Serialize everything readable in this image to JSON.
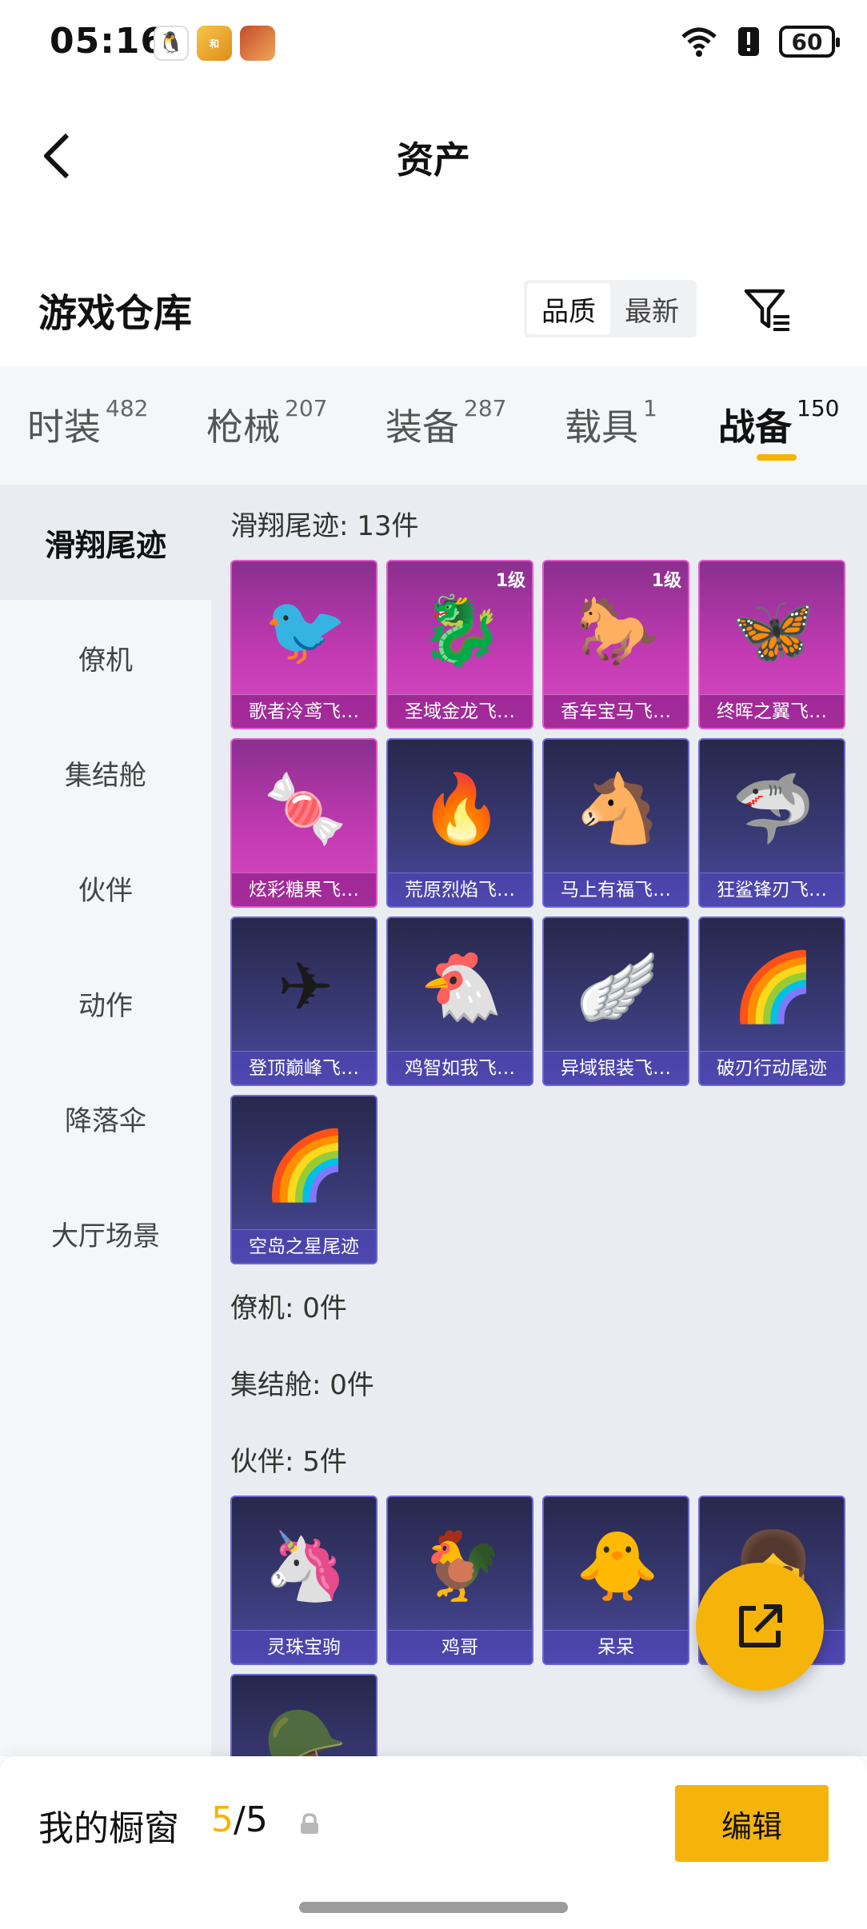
{
  "status_bar": {
    "time": "05:16",
    "battery": "60"
  },
  "nav": {
    "title": "资产"
  },
  "warehouse": {
    "title": "游戏仓库",
    "sort_options": [
      "品质",
      "最新"
    ],
    "active_sort": "品质"
  },
  "categories": [
    {
      "label": "时装",
      "count": "482"
    },
    {
      "label": "枪械",
      "count": "207"
    },
    {
      "label": "装备",
      "count": "287"
    },
    {
      "label": "载具",
      "count": "1"
    },
    {
      "label": "战备",
      "count": "150"
    }
  ],
  "active_category": "战备",
  "sidebar": {
    "items": [
      "滑翔尾迹",
      "僚机",
      "集结舱",
      "伙伴",
      "动作",
      "降落伞",
      "大厅场景"
    ],
    "active": "滑翔尾迹"
  },
  "sections": {
    "glide": {
      "title": "滑翔尾迹: 13件",
      "items": [
        {
          "label": "歌者泠鸢飞…",
          "level": "",
          "icon": "red-bird",
          "glyph": "🐦"
        },
        {
          "label": "圣域金龙飞…",
          "level": "1级",
          "icon": "golden-dragon",
          "glyph": "🐉"
        },
        {
          "label": "香车宝马飞…",
          "level": "1级",
          "icon": "carriage",
          "glyph": "🐎"
        },
        {
          "label": "终晖之翼飞…",
          "level": "",
          "icon": "wings",
          "glyph": "🦋"
        },
        {
          "label": "炫彩糖果飞…",
          "level": "",
          "icon": "candy",
          "glyph": "🍬"
        },
        {
          "label": "荒原烈焰飞…",
          "level": "",
          "icon": "flame-craft",
          "glyph": "🔥"
        },
        {
          "label": "马上有福飞…",
          "level": "",
          "icon": "pony",
          "glyph": "🐴"
        },
        {
          "label": "狂鲨锋刃飞…",
          "level": "",
          "icon": "shark-jet",
          "glyph": "🦈"
        },
        {
          "label": "登顶巅峰飞…",
          "level": "",
          "icon": "glider-white",
          "glyph": "✈"
        },
        {
          "label": "鸡智如我飞…",
          "level": "",
          "icon": "chicken",
          "glyph": "🐔"
        },
        {
          "label": "异域银装飞…",
          "level": "",
          "icon": "silver-wing",
          "glyph": "🪽"
        },
        {
          "label": "破刃行动尾迹",
          "level": "",
          "icon": "rainbow-trail",
          "glyph": "🌈"
        },
        {
          "label": "空岛之星尾迹",
          "level": "",
          "icon": "star-trail",
          "glyph": "🌈"
        }
      ]
    },
    "wingman": {
      "title": "僚机: 0件"
    },
    "pod": {
      "title": "集结舱: 0件"
    },
    "partner": {
      "title": "伙伴: 5件",
      "items": [
        {
          "label": "灵珠宝驹",
          "icon": "pony-white",
          "glyph": "🦄"
        },
        {
          "label": "鸡哥",
          "icon": "chicken-cool",
          "glyph": "🐓"
        },
        {
          "label": "呆呆",
          "icon": "chick",
          "glyph": "🐥"
        },
        {
          "label": "",
          "icon": "pink-hair-girl",
          "glyph": "👧"
        },
        {
          "label": "",
          "icon": "helmet-chicken",
          "glyph": "🪖"
        }
      ]
    }
  },
  "bottom": {
    "title": "我的橱窗",
    "current": "5",
    "total": "/5",
    "edit_label": "编辑"
  },
  "colors": {
    "accent": "#f6b40b",
    "purple_card": "#c23ab3",
    "blue_card": "#3a3b78"
  }
}
